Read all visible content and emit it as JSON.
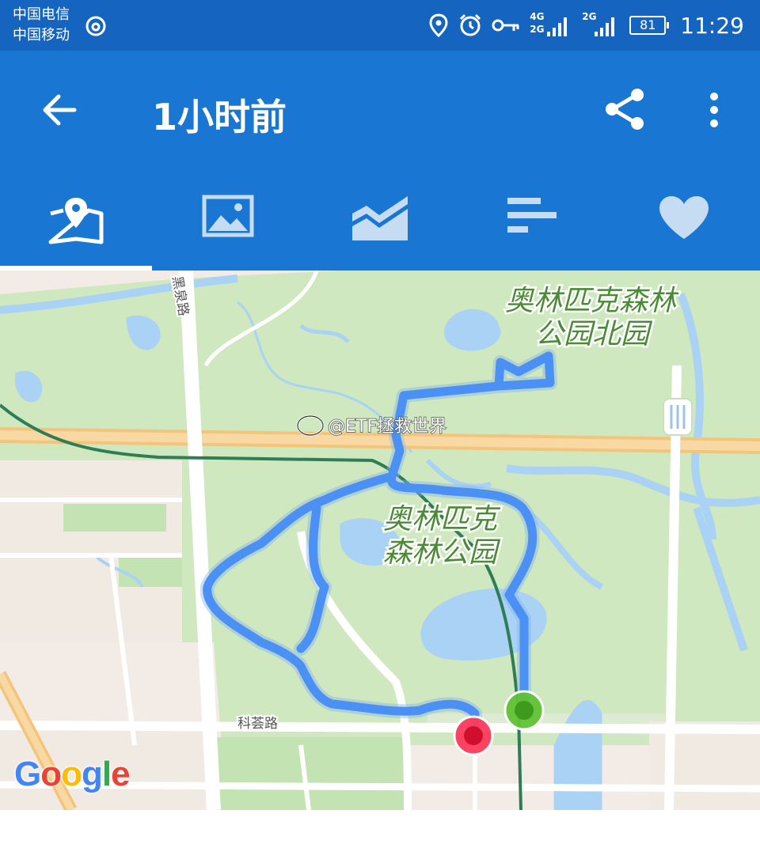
{
  "status_bar": {
    "carrier_1": "中国电信",
    "carrier_2": "中国移动",
    "network_1": "4G",
    "network_2": "2G",
    "network_3": "2G",
    "battery": "81",
    "time": "11:29"
  },
  "app_bar": {
    "title": "1小时前",
    "back_icon": "arrow-left",
    "share_icon": "share",
    "more_icon": "more-vert"
  },
  "tabs": [
    {
      "icon": "map-pin",
      "selected": true
    },
    {
      "icon": "image",
      "selected": false
    },
    {
      "icon": "area-chart",
      "selected": false
    },
    {
      "icon": "bar-list",
      "selected": false
    },
    {
      "icon": "heart",
      "selected": false
    }
  ],
  "map": {
    "labels": {
      "park_north_line1": "奥林匹克森林",
      "park_north_line2": "公园北园",
      "park_line1": "奥林匹克",
      "park_line2": "森林公园",
      "road_heiquan": "黑泉路",
      "road_kehui": "科荟路"
    },
    "watermark": "@ETF拯救世界",
    "attribution": "Google",
    "start_marker_color": "#62c236",
    "end_marker_color": "#e8173f",
    "route_color": "#4a90f5"
  },
  "colors": {
    "status_bar": "#1565c0",
    "app_bar": "#1976d2",
    "park_green": "#cfe8bf",
    "water_blue": "#a9d2f5"
  }
}
